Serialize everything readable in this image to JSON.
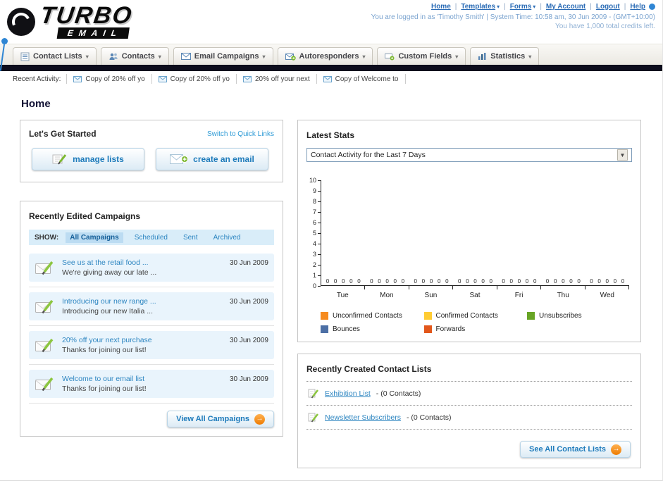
{
  "header": {
    "logo_line1": "TURBO",
    "logo_line2": "EMAIL",
    "nav": [
      {
        "label": "Home"
      },
      {
        "label": "Templates"
      },
      {
        "label": "Forms"
      },
      {
        "label": "My Account"
      },
      {
        "label": "Logout"
      },
      {
        "label": "Help"
      }
    ],
    "session_line": "You are logged in as 'Timothy Smith' | System Time: 10:58 am, 30 Jun 2009 - (GMT+10:00)",
    "credits_line": "You have 1,000 total credits left."
  },
  "tabs": [
    {
      "label": "Contact Lists"
    },
    {
      "label": "Contacts"
    },
    {
      "label": "Email Campaigns"
    },
    {
      "label": "Autoresponders"
    },
    {
      "label": "Custom Fields"
    },
    {
      "label": "Statistics"
    }
  ],
  "recent_activity": {
    "label": "Recent Activity:",
    "items": [
      {
        "text": "Copy of 20% off yo"
      },
      {
        "text": "Copy of 20% off yo"
      },
      {
        "text": "20% off your next"
      },
      {
        "text": "Copy of Welcome to"
      }
    ]
  },
  "page_title": "Home",
  "get_started": {
    "title": "Let's Get Started",
    "switch_link": "Switch to Quick Links",
    "manage_lists_label": "manage lists",
    "create_email_label": "create an email"
  },
  "campaigns": {
    "title": "Recently Edited Campaigns",
    "show_label": "SHOW:",
    "filters": [
      {
        "label": "All Campaigns"
      },
      {
        "label": "Scheduled"
      },
      {
        "label": "Sent"
      },
      {
        "label": "Archived"
      }
    ],
    "items": [
      {
        "title": "See us at the retail food ...",
        "subtitle": "We're giving away our late ...",
        "date": "30 Jun 2009"
      },
      {
        "title": "Introducing our new range ...",
        "subtitle": "Introducing our new Italia ...",
        "date": "30 Jun 2009"
      },
      {
        "title": "20% off your next purchase",
        "subtitle": "Thanks for joining our list!",
        "date": "30 Jun 2009"
      },
      {
        "title": "Welcome to our email list",
        "subtitle": "Thanks for joining our list!",
        "date": "30 Jun 2009"
      }
    ],
    "view_all_label": "View All Campaigns"
  },
  "latest_stats": {
    "title": "Latest Stats",
    "dropdown_value": "Contact Activity for the Last 7 Days"
  },
  "chart_data": {
    "type": "bar",
    "title": "Contact Activity for the Last 7 Days",
    "categories": [
      "Tue",
      "Mon",
      "Sun",
      "Sat",
      "Fri",
      "Thu",
      "Wed"
    ],
    "series": [
      {
        "name": "Unconfirmed Contacts",
        "color": "#F68B1F",
        "values": [
          0,
          0,
          0,
          0,
          0,
          0,
          0
        ]
      },
      {
        "name": "Confirmed Contacts",
        "color": "#FFCC33",
        "values": [
          0,
          0,
          0,
          0,
          0,
          0,
          0
        ]
      },
      {
        "name": "Unsubscribes",
        "color": "#68A525",
        "values": [
          0,
          0,
          0,
          0,
          0,
          0,
          0
        ]
      },
      {
        "name": "Bounces",
        "color": "#4C6FA5",
        "values": [
          0,
          0,
          0,
          0,
          0,
          0,
          0
        ]
      },
      {
        "name": "Forwards",
        "color": "#E2571B",
        "values": [
          0,
          0,
          0,
          0,
          0,
          0,
          0
        ]
      }
    ],
    "xlabel": "",
    "ylabel": "",
    "ylim": [
      0,
      10
    ],
    "yticks": [
      0,
      1,
      2,
      3,
      4,
      5,
      6,
      7,
      8,
      9,
      10
    ],
    "grid": false,
    "legend_position": "bottom"
  },
  "contact_lists": {
    "title": "Recently Created Contact Lists",
    "items": [
      {
        "name": "Exhibition List",
        "detail": "- (0 Contacts)"
      },
      {
        "name": "Newsletter Subscribers",
        "detail": "- (0 Contacts)"
      }
    ],
    "see_all_label": "See All Contact Lists"
  },
  "icons": {
    "arrow_right": "→",
    "dropdown_arrow": "▾",
    "select_arrow": "▼"
  }
}
